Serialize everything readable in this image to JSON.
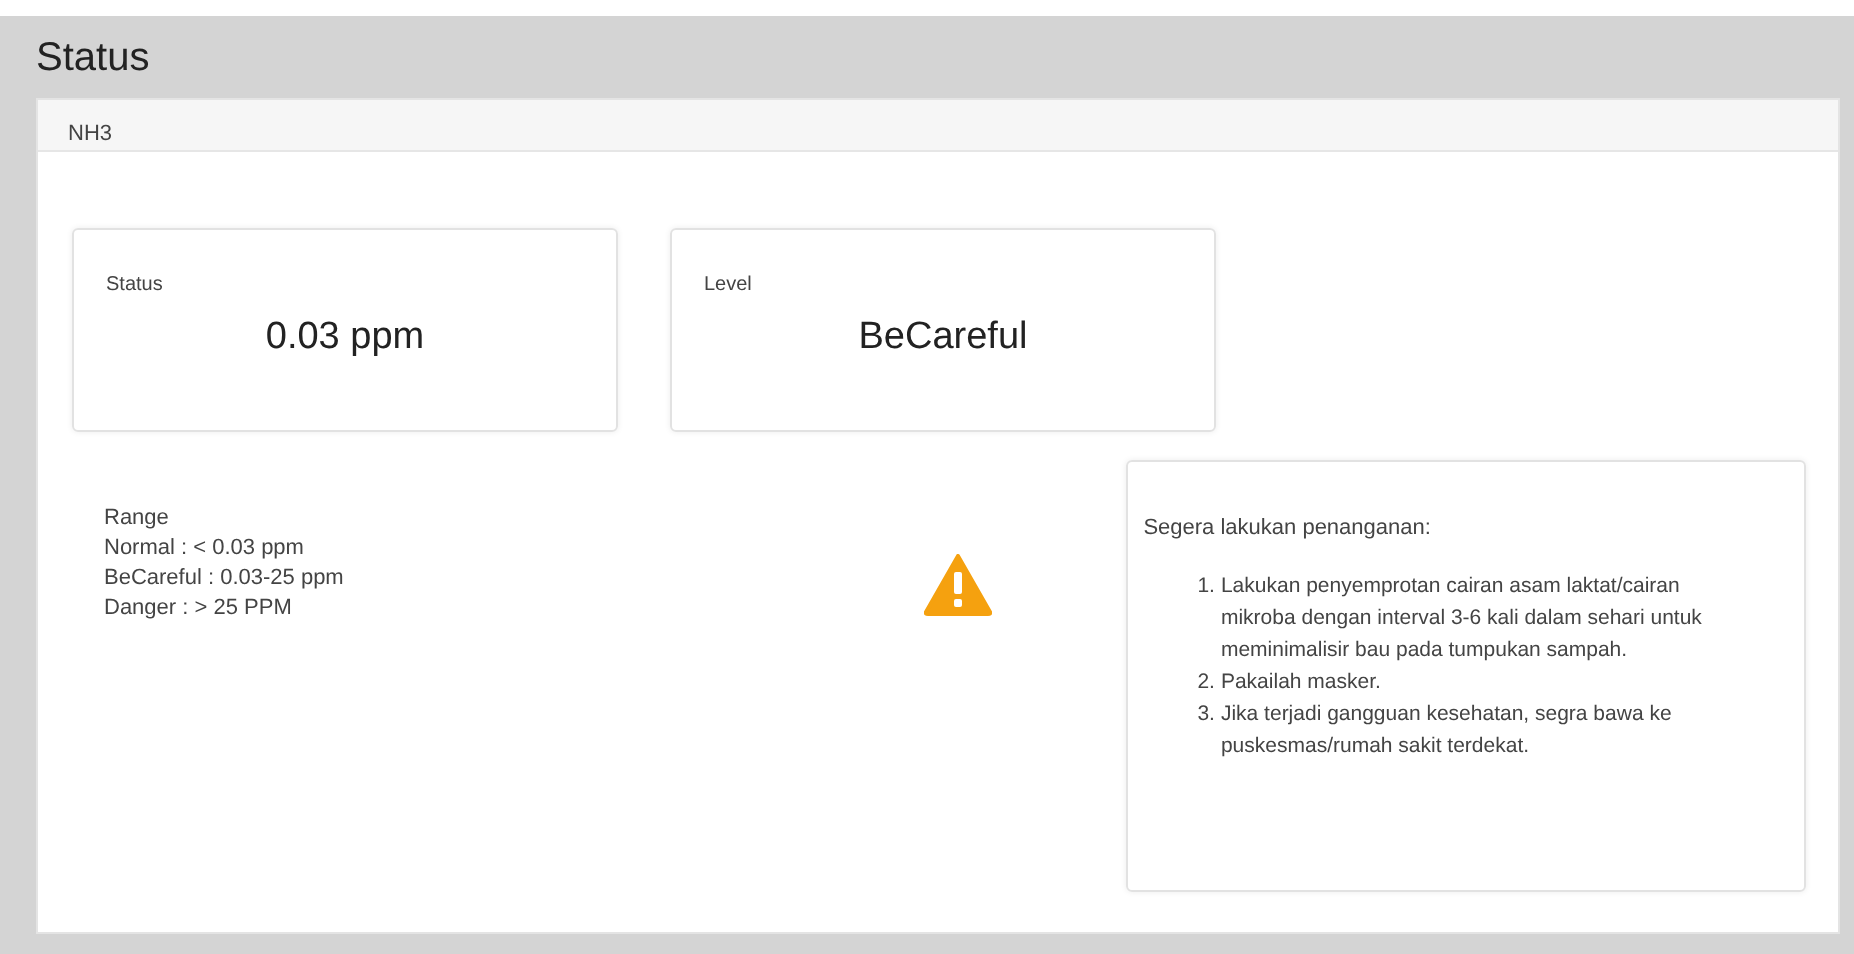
{
  "page_title": "Status",
  "card": {
    "header": "NH3",
    "tiles": [
      {
        "label": "Status",
        "value": "0.03 ppm"
      },
      {
        "label": "Level",
        "value": "BeCareful"
      }
    ],
    "range": {
      "title": "Range",
      "lines": [
        "Normal : < 0.03 ppm",
        "BeCareful : 0.03-25 ppm",
        "Danger : > 25 PPM"
      ]
    },
    "advice": {
      "title": "Segera lakukan penanganan:",
      "steps": [
        {
          "number": "1.",
          "text": "Lakukan penyemprotan cairan asam laktat/cairan mikroba dengan interval 3-6 kali dalam sehari untuk meminimalisir bau pada tumpukan sampah."
        },
        {
          "number": "2.",
          "text": "Pakailah masker."
        },
        {
          "number": "3.",
          "text": "Jika terjadi gangguan kesehatan, segra bawa ke puskesmas/rumah sakit terdekat."
        }
      ]
    }
  }
}
